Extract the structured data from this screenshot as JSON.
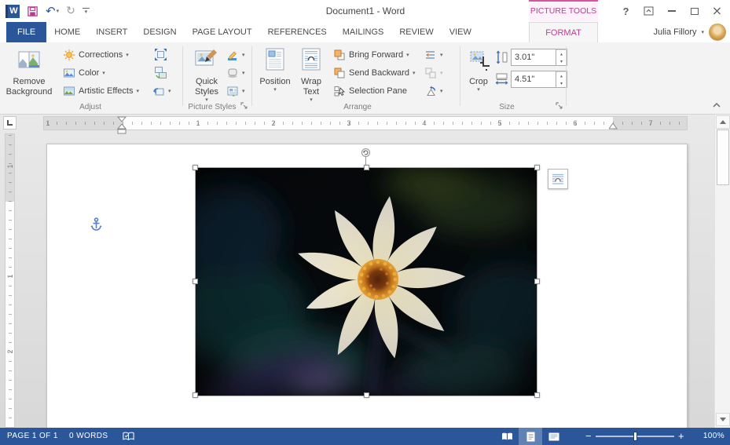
{
  "colors": {
    "accent_blue": "#2B579A",
    "contextual_pink": "#BB3D92",
    "icon_orange": "#F5B26B",
    "statusbar_blue": "#2B579A"
  },
  "titlebar": {
    "title": "Document1 - Word",
    "contextual_tools_label": "PICTURE TOOLS",
    "help_label": "?"
  },
  "tabs": [
    "FILE",
    "HOME",
    "INSERT",
    "DESIGN",
    "PAGE LAYOUT",
    "REFERENCES",
    "MAILINGS",
    "REVIEW",
    "VIEW",
    "FORMAT"
  ],
  "user": {
    "name": "Julia Fillory"
  },
  "ribbon": {
    "adjust": {
      "remove_background": "Remove Background",
      "corrections": "Corrections",
      "color": "Color",
      "artistic_effects": "Artistic Effects",
      "group_label": "Adjust"
    },
    "picture_styles": {
      "quick_styles": "Quick Styles",
      "group_label": "Picture Styles"
    },
    "arrange": {
      "position": "Position",
      "wrap_text": "Wrap Text",
      "bring_forward": "Bring Forward",
      "send_backward": "Send Backward",
      "selection_pane": "Selection Pane",
      "group_label": "Arrange"
    },
    "size": {
      "crop": "Crop",
      "height_value": "3.01\"",
      "width_value": "4.51\"",
      "group_label": "Size"
    }
  },
  "ruler": {
    "h_marks": [
      "1",
      "1",
      "2",
      "3",
      "4",
      "5",
      "6",
      "7"
    ],
    "v_marks": [
      "1",
      "1",
      "2"
    ]
  },
  "statusbar": {
    "page_info": "PAGE 1 OF 1",
    "word_count": "0 WORDS",
    "zoom_level": "100%"
  },
  "icons": {
    "dropdown": "▾",
    "undo": "↶",
    "redo": "↻",
    "close": "×",
    "zoom_out": "−",
    "zoom_in": "+"
  }
}
